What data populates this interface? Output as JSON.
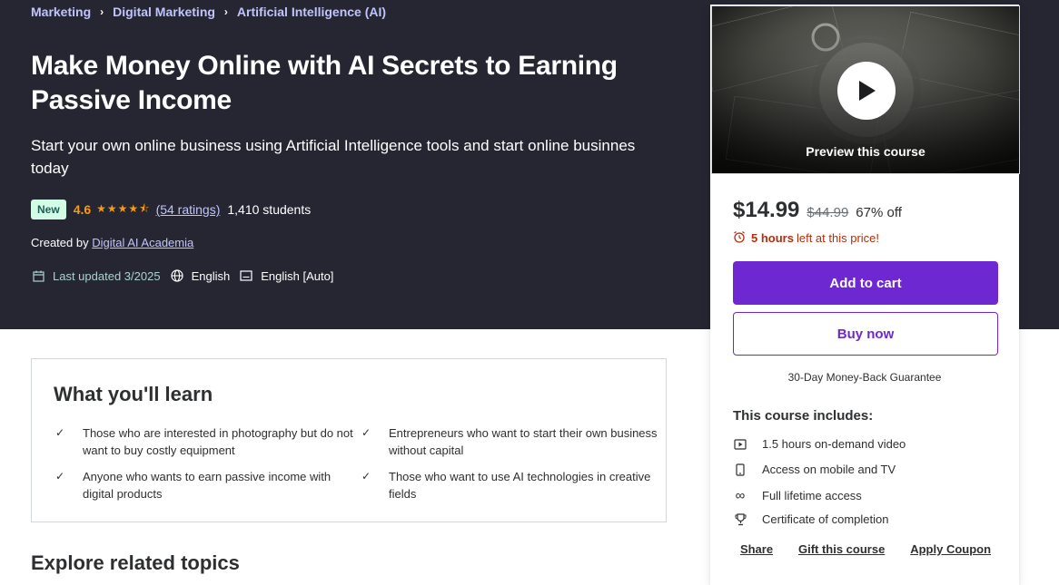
{
  "breadcrumb": [
    "Marketing",
    "Digital Marketing",
    "Artificial Intelligence (AI)"
  ],
  "course": {
    "title": "Make Money Online with AI Secrets to Earning Passive Income",
    "subtitle": "Start your own online business using Artificial Intelligence tools and start online businnes today",
    "badge": "New",
    "rating": "4.6",
    "stars": "★★★★⯪",
    "ratings_count": "(54 ratings)",
    "students": "1,410 students",
    "created_by_label": "Created by",
    "author": "Digital AI Academia",
    "last_updated": "Last updated 3/2025",
    "language": "English",
    "captions": "English [Auto]"
  },
  "learn": {
    "heading": "What you'll learn",
    "items": [
      "Those who are interested in photography but do not want to buy costly equipment",
      "Entrepreneurs who want to start their own business without capital",
      "Anyone who wants to earn passive income with digital products",
      "Those who want to use AI technologies in creative fields"
    ]
  },
  "explore_heading": "Explore related topics",
  "card": {
    "preview_label": "Preview this course",
    "price": "$14.99",
    "original_price": "$44.99",
    "discount": "67% off",
    "timer_hours": "5 hours",
    "timer_rest": "left at this price!",
    "add_to_cart": "Add to cart",
    "buy_now": "Buy now",
    "guarantee": "30-Day Money-Back Guarantee",
    "includes_title": "This course includes:",
    "includes": [
      "1.5 hours on-demand video",
      "Access on mobile and TV",
      "Full lifetime access",
      "Certificate of completion"
    ],
    "share": "Share",
    "gift": "Gift this course",
    "coupon": "Apply Coupon"
  },
  "colors": {
    "hero_bg": "#262633",
    "accent": "#6d28d2",
    "star": "#f69c08",
    "link": "#c0c4fc",
    "alert": "#b32d0f"
  }
}
